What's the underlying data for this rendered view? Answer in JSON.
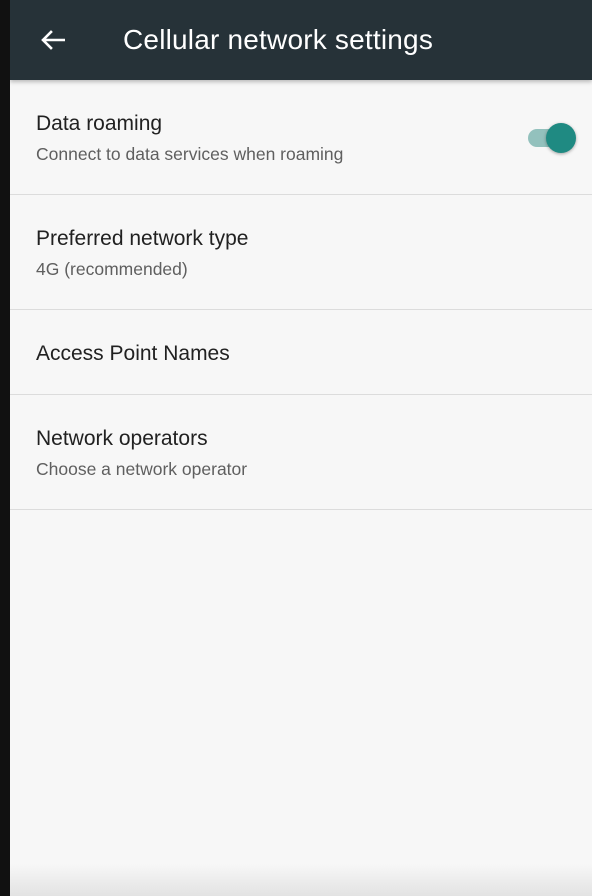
{
  "toolbar": {
    "title": "Cellular network settings",
    "back_icon": "arrow-back-icon",
    "background_color": "#263238"
  },
  "settings": [
    {
      "title": "Data roaming",
      "summary": "Connect to data services when roaming",
      "toggle": true,
      "toggle_color": "#1f8a82"
    },
    {
      "title": "Preferred network type",
      "summary": "4G (recommended)"
    },
    {
      "title": "Access Point Names"
    },
    {
      "title": "Network operators",
      "summary": "Choose a network operator"
    }
  ]
}
